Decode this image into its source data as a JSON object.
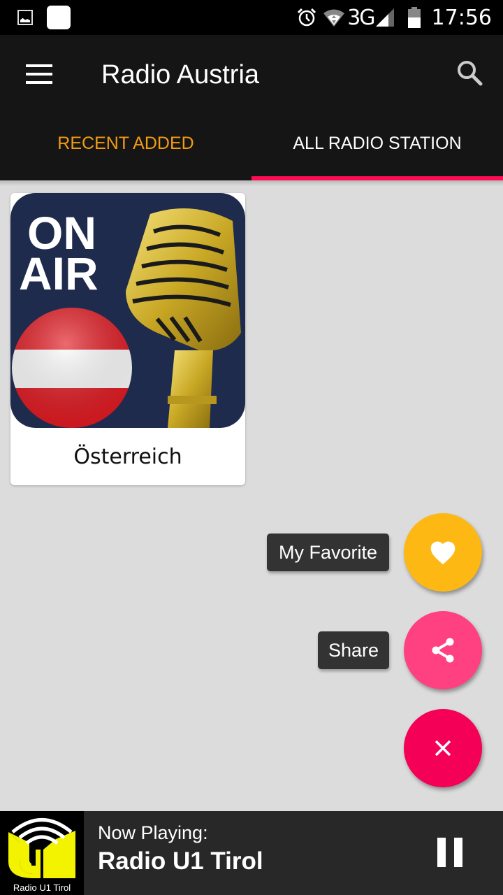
{
  "status_bar": {
    "left_icons": [
      "gallery-notification-icon",
      "app-notification-icon"
    ],
    "right_icons": [
      "alarm-icon",
      "wifi-icon",
      "network-3g-icon",
      "signal-icon",
      "battery-icon"
    ],
    "network_type": "3G",
    "time": "17:56"
  },
  "app_bar": {
    "menu_icon": "hamburger-menu-icon",
    "title": "Radio Austria",
    "search_icon": "search-icon"
  },
  "tabs": [
    {
      "label": "RECENT ADDED",
      "active": false,
      "color": "#f39c12"
    },
    {
      "label": "ALL RADIO STATION",
      "active": true,
      "color": "#ffffff"
    }
  ],
  "accent_color": "#ff0a54",
  "stations": [
    {
      "name": "Österreich",
      "image": {
        "text_line1": "ON",
        "text_line2": "AIR",
        "description": "Austrian flag sphere and golden microphone"
      }
    }
  ],
  "fab_menu": {
    "items": [
      {
        "label": "My Favorite",
        "icon": "heart-icon",
        "color": "#fdb813"
      },
      {
        "label": "Share",
        "icon": "share-icon",
        "color": "#ff4081"
      }
    ],
    "close": {
      "icon": "close-icon",
      "color": "#f50057"
    }
  },
  "player": {
    "logo_text": "Radio U1 Tirol",
    "now_playing_label": "Now Playing:",
    "station_name": "Radio U1 Tirol",
    "state": "playing",
    "control_icon": "pause-icon"
  }
}
